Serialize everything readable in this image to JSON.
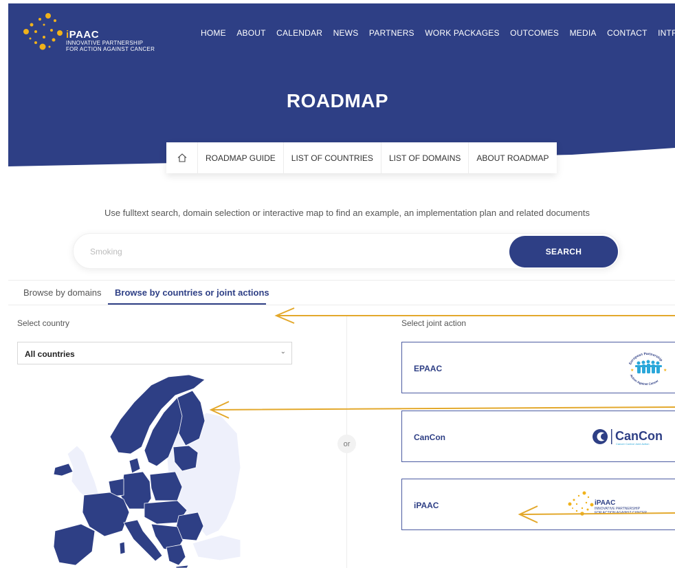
{
  "brand": {
    "title_i": "i",
    "title_rest": "PAAC",
    "subtitle_line1": "INNOVATIVE PARTNERSHIP",
    "subtitle_line2": "FOR ACTION AGAINST CANCER"
  },
  "topnav": [
    "HOME",
    "ABOUT",
    "CALENDAR",
    "NEWS",
    "PARTNERS",
    "WORK PACKAGES",
    "OUTCOMES",
    "MEDIA",
    "CONTACT",
    "INTRANET"
  ],
  "page_title": "ROADMAP",
  "subnav": {
    "home_icon": "home-icon",
    "items": [
      "ROADMAP GUIDE",
      "LIST OF COUNTRIES",
      "LIST OF DOMAINS",
      "ABOUT ROADMAP"
    ]
  },
  "hint": "Use fulltext search, domain selection or interactive map to find an example, an implementation plan and related documents",
  "search": {
    "placeholder": "Smoking",
    "button": "SEARCH"
  },
  "tabs": {
    "domains": "Browse by domains",
    "countries": "Browse by countries or joint actions",
    "active": "countries"
  },
  "country": {
    "label": "Select country",
    "selected": "All countries"
  },
  "or_label": "or",
  "joint_actions": {
    "label": "Select joint action",
    "items": [
      {
        "name": "EPAAC",
        "logo_lines": [
          "European Partnership",
          "Action Against Cancer"
        ]
      },
      {
        "name": "CanCon",
        "logo_text": "CanCon",
        "logo_sub": "Cancer Control Joint Action"
      },
      {
        "name": "iPAAC",
        "logo_title": "iPAAC",
        "logo_line1": "INNOVATIVE PARTNERSHIP",
        "logo_line2": "FOR ACTION AGAINST CANCER"
      }
    ]
  },
  "colors": {
    "brand_blue": "#2e3f85",
    "accent_gold": "#f0b21b",
    "map_inactive": "#eef0fb",
    "arrow": "#e3a82b"
  }
}
